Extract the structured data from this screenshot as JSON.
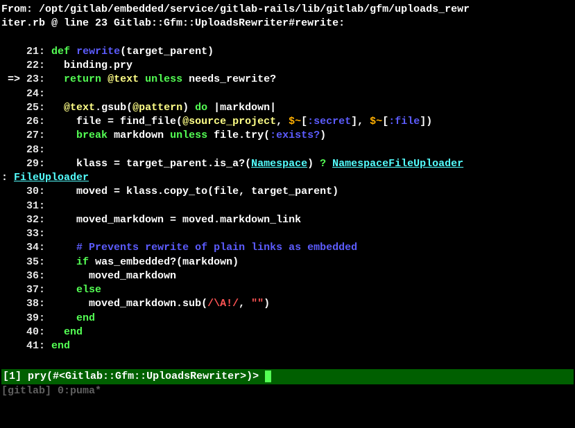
{
  "header": {
    "from_label": "From:",
    "path": " /opt/gitlab/embedded/service/gitlab-rails/lib/gitlab/gfm/uploads_rewr\niter.rb @ line 23 Gitlab::Gfm::UploadsRewriter#rewrite:"
  },
  "code_lines": [
    {
      "num": "21",
      "prefix": "    ",
      "content": [
        {
          "t": "def",
          "c": "green"
        },
        {
          "t": " ",
          "c": ""
        },
        {
          "t": "rewrite",
          "c": "blue"
        },
        {
          "t": "(target_parent)",
          "c": ""
        }
      ]
    },
    {
      "num": "22",
      "prefix": "    ",
      "content": [
        {
          "t": "  binding.pry",
          "c": ""
        }
      ]
    },
    {
      "num": "23",
      "prefix": " => ",
      "content": [
        {
          "t": "  ",
          "c": ""
        },
        {
          "t": "return",
          "c": "green"
        },
        {
          "t": " ",
          "c": ""
        },
        {
          "t": "@text",
          "c": "beige"
        },
        {
          "t": " ",
          "c": ""
        },
        {
          "t": "unless",
          "c": "green"
        },
        {
          "t": " needs_rewrite?",
          "c": ""
        }
      ]
    },
    {
      "num": "24",
      "prefix": "    ",
      "content": []
    },
    {
      "num": "25",
      "prefix": "    ",
      "content": [
        {
          "t": "  ",
          "c": ""
        },
        {
          "t": "@text",
          "c": "beige"
        },
        {
          "t": ".gsub(",
          "c": ""
        },
        {
          "t": "@pattern",
          "c": "beige"
        },
        {
          "t": ") ",
          "c": ""
        },
        {
          "t": "do",
          "c": "green"
        },
        {
          "t": " |markdown|",
          "c": ""
        }
      ]
    },
    {
      "num": "26",
      "prefix": "    ",
      "content": [
        {
          "t": "    file = find_file(",
          "c": ""
        },
        {
          "t": "@source_project",
          "c": "beige"
        },
        {
          "t": ", ",
          "c": ""
        },
        {
          "t": "$~",
          "c": "orange"
        },
        {
          "t": "[",
          "c": ""
        },
        {
          "t": ":secret",
          "c": "blue"
        },
        {
          "t": "], ",
          "c": ""
        },
        {
          "t": "$~",
          "c": "orange"
        },
        {
          "t": "[",
          "c": ""
        },
        {
          "t": ":file",
          "c": "blue"
        },
        {
          "t": "])",
          "c": ""
        }
      ]
    },
    {
      "num": "27",
      "prefix": "    ",
      "content": [
        {
          "t": "    ",
          "c": ""
        },
        {
          "t": "break",
          "c": "green"
        },
        {
          "t": " markdown ",
          "c": ""
        },
        {
          "t": "unless",
          "c": "green"
        },
        {
          "t": " file.try(",
          "c": ""
        },
        {
          "t": ":exists?",
          "c": "blue"
        },
        {
          "t": ")",
          "c": ""
        }
      ]
    },
    {
      "num": "28",
      "prefix": "    ",
      "content": []
    },
    {
      "num": "29",
      "prefix": "    ",
      "content": [
        {
          "t": "    klass = target_parent.is_a?(",
          "c": ""
        },
        {
          "t": "Namespace",
          "c": "cyan"
        },
        {
          "t": ") ",
          "c": ""
        },
        {
          "t": "?",
          "c": "green"
        },
        {
          "t": " ",
          "c": ""
        },
        {
          "t": "NamespaceFileUploader",
          "c": "cyan"
        }
      ]
    }
  ],
  "wrap_line": {
    "prefix": ": ",
    "class_text": "FileUploader"
  },
  "code_lines2": [
    {
      "num": "30",
      "prefix": "    ",
      "content": [
        {
          "t": "    moved = klass.copy_to(file, target_parent)",
          "c": ""
        }
      ]
    },
    {
      "num": "31",
      "prefix": "    ",
      "content": []
    },
    {
      "num": "32",
      "prefix": "    ",
      "content": [
        {
          "t": "    moved_markdown = moved.markdown_link",
          "c": ""
        }
      ]
    },
    {
      "num": "33",
      "prefix": "    ",
      "content": []
    },
    {
      "num": "34",
      "prefix": "    ",
      "content": [
        {
          "t": "    ",
          "c": ""
        },
        {
          "t": "# Prevents rewrite of plain links as embedded",
          "c": "blue"
        }
      ]
    },
    {
      "num": "35",
      "prefix": "    ",
      "content": [
        {
          "t": "    ",
          "c": ""
        },
        {
          "t": "if",
          "c": "green"
        },
        {
          "t": " was_embedded?(markdown)",
          "c": ""
        }
      ]
    },
    {
      "num": "36",
      "prefix": "    ",
      "content": [
        {
          "t": "      moved_markdown",
          "c": ""
        }
      ]
    },
    {
      "num": "37",
      "prefix": "    ",
      "content": [
        {
          "t": "    ",
          "c": ""
        },
        {
          "t": "else",
          "c": "green"
        }
      ]
    },
    {
      "num": "38",
      "prefix": "    ",
      "content": [
        {
          "t": "      moved_markdown.sub(",
          "c": ""
        },
        {
          "t": "/\\A!/",
          "c": "red"
        },
        {
          "t": ", ",
          "c": ""
        },
        {
          "t": "\"\"",
          "c": "red"
        },
        {
          "t": ")",
          "c": ""
        }
      ]
    },
    {
      "num": "39",
      "prefix": "    ",
      "content": [
        {
          "t": "    ",
          "c": ""
        },
        {
          "t": "end",
          "c": "green"
        }
      ]
    },
    {
      "num": "40",
      "prefix": "    ",
      "content": [
        {
          "t": "  ",
          "c": ""
        },
        {
          "t": "end",
          "c": "green"
        }
      ]
    },
    {
      "num": "41",
      "prefix": "    ",
      "content": [
        {
          "t": "end",
          "c": "green"
        }
      ]
    }
  ],
  "prompt": {
    "prefix": "[",
    "num": "1",
    "mid": "] pry(",
    "obj": "#<Gitlab::Gfm::UploadsRewriter>",
    "suffix": ")> "
  },
  "status": "[gitlab] 0:puma*"
}
